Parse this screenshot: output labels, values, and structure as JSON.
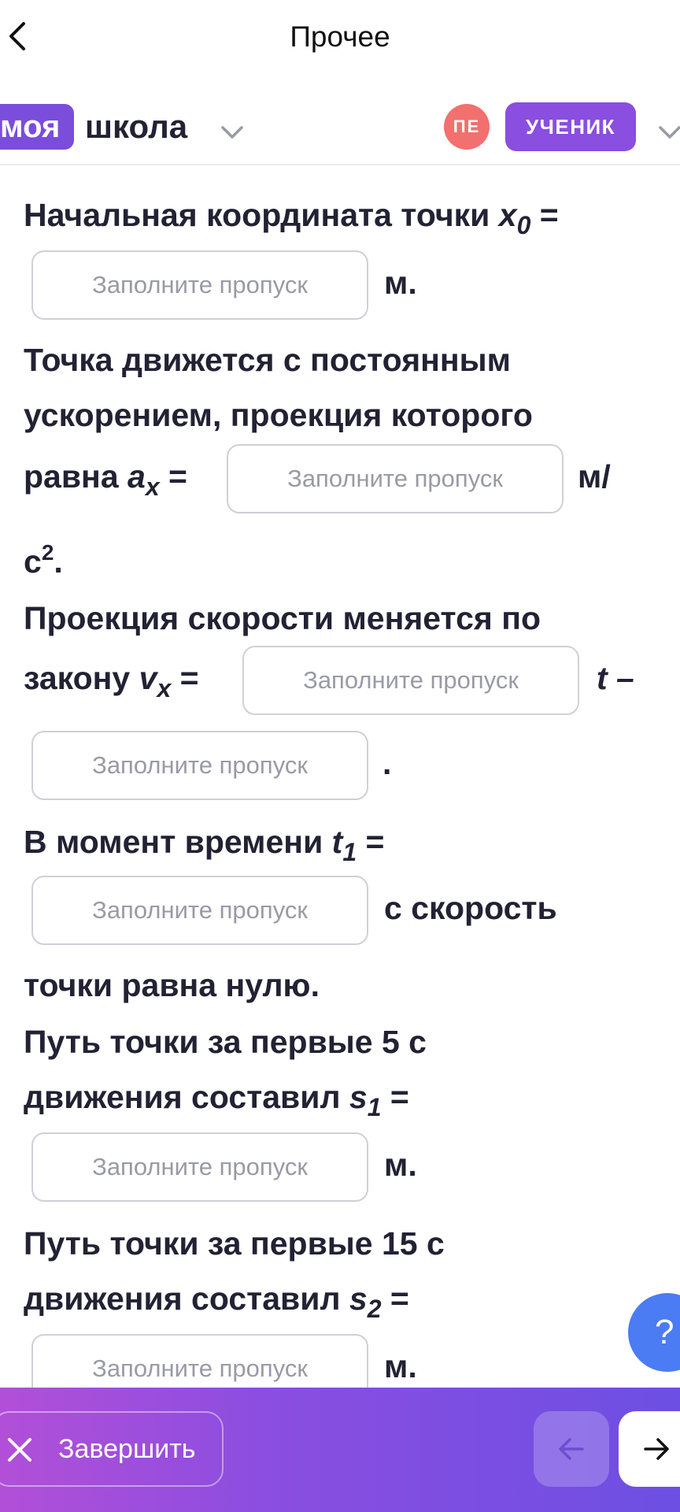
{
  "nav": {
    "title": "Прочее"
  },
  "header": {
    "logo_badge": "моя",
    "logo_text": "школа",
    "avatar_initials": "ПЕ",
    "role": "УЧЕНИК"
  },
  "task": {
    "placeholder": "Заполните пропуск",
    "l1_text": "Начальная координата точки ",
    "l1_var": "x",
    "l1_sub": "0",
    "eq": " =",
    "unit_m": "м.",
    "l3": "Точка движется с постоянным",
    "l4": "ускорением, проекция которого",
    "l5_text": "равна ",
    "l5_var": "a",
    "l5_sub": "x",
    "unit_ms": "м/",
    "l6_c": "с",
    "l6_sup": "2",
    "l6_dot": ".",
    "l7": "Проекция скорости меняется по",
    "l8_text": "закону ",
    "l8_var": "v",
    "l8_sub": "x",
    "l8_t": "t –",
    "dot": ".",
    "l10_text": "В момент времени ",
    "l10_var": "t",
    "l10_sub": "1",
    "l11_tail": "с скорость",
    "l12": "точки равна нулю.",
    "l13": "Путь точки за первые 5 с",
    "l14_text": "движения составил ",
    "l14_var": "s",
    "l14_sub": "1",
    "l16": "Путь точки за первые 15 с",
    "l17_text": "движения составил ",
    "l17_var": "s",
    "l17_sub": "2"
  },
  "help": {
    "label": "?"
  },
  "footer": {
    "finish_label": "Завершить"
  },
  "icons": {
    "back": "chevron-left-icon",
    "dropdown": "chevron-down-icon",
    "close": "close-icon",
    "prev": "arrow-left-icon",
    "next": "arrow-right-icon"
  },
  "colors": {
    "brand_purple": "#8a4ee0",
    "avatar_red": "#f2706e",
    "help_blue": "#4b7cf3",
    "text_dark": "#232234"
  }
}
